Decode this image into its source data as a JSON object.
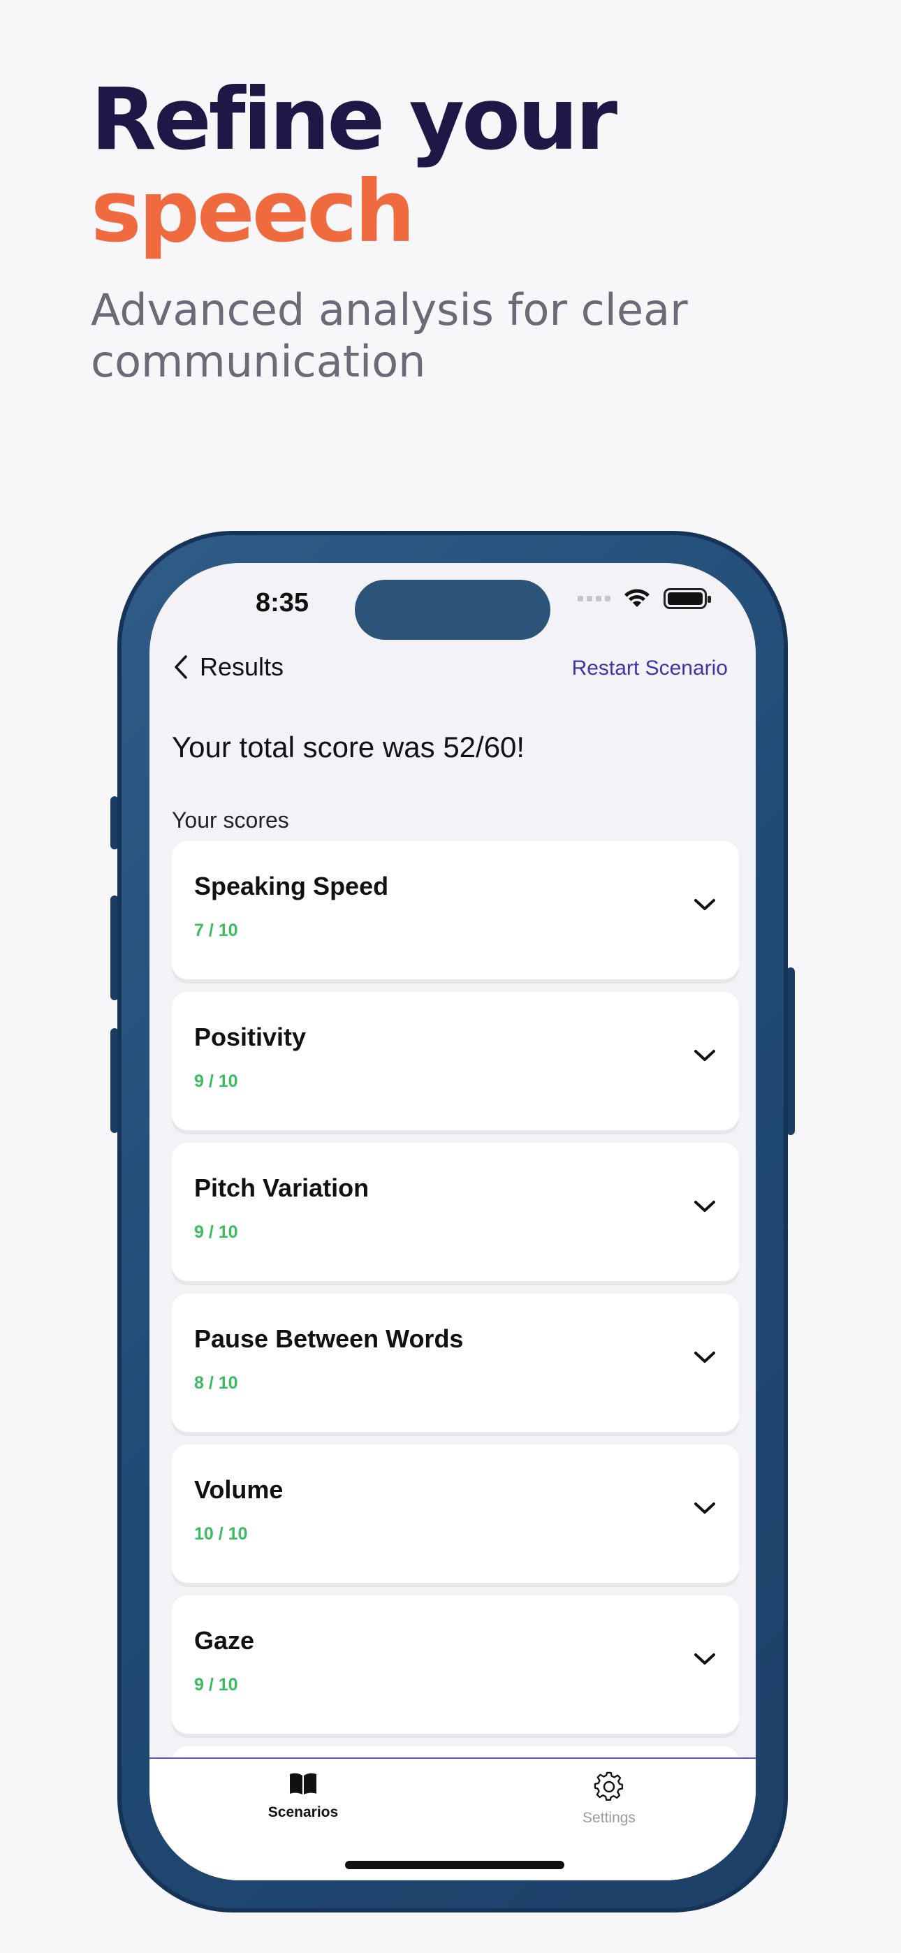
{
  "hero": {
    "title_line1": "Refine your",
    "title_line2": "speech",
    "subtitle": "Advanced analysis for clear communication",
    "title_color": "#1f1745",
    "accent_color": "#ef6a3e"
  },
  "status_bar": {
    "time": "8:35"
  },
  "nav": {
    "back_label": "Results",
    "restart_label": "Restart Scenario",
    "accent_color": "#3c36a8"
  },
  "results": {
    "total_score_text": "Your total score was 52/60!",
    "section_label": "Your scores",
    "score_color": "#3dbb63",
    "scores": [
      {
        "name": "Speaking Speed",
        "score": "7 / 10"
      },
      {
        "name": "Positivity",
        "score": "9 / 10"
      },
      {
        "name": "Pitch Variation",
        "score": "9 / 10"
      },
      {
        "name": "Pause Between Words",
        "score": "8 / 10"
      },
      {
        "name": "Volume",
        "score": "10 / 10"
      },
      {
        "name": "Gaze",
        "score": "9 / 10"
      }
    ]
  },
  "tabbar": {
    "tabs": [
      {
        "label": "Scenarios",
        "icon": "book-icon",
        "active": true
      },
      {
        "label": "Settings",
        "icon": "gear-icon",
        "active": false
      }
    ]
  }
}
